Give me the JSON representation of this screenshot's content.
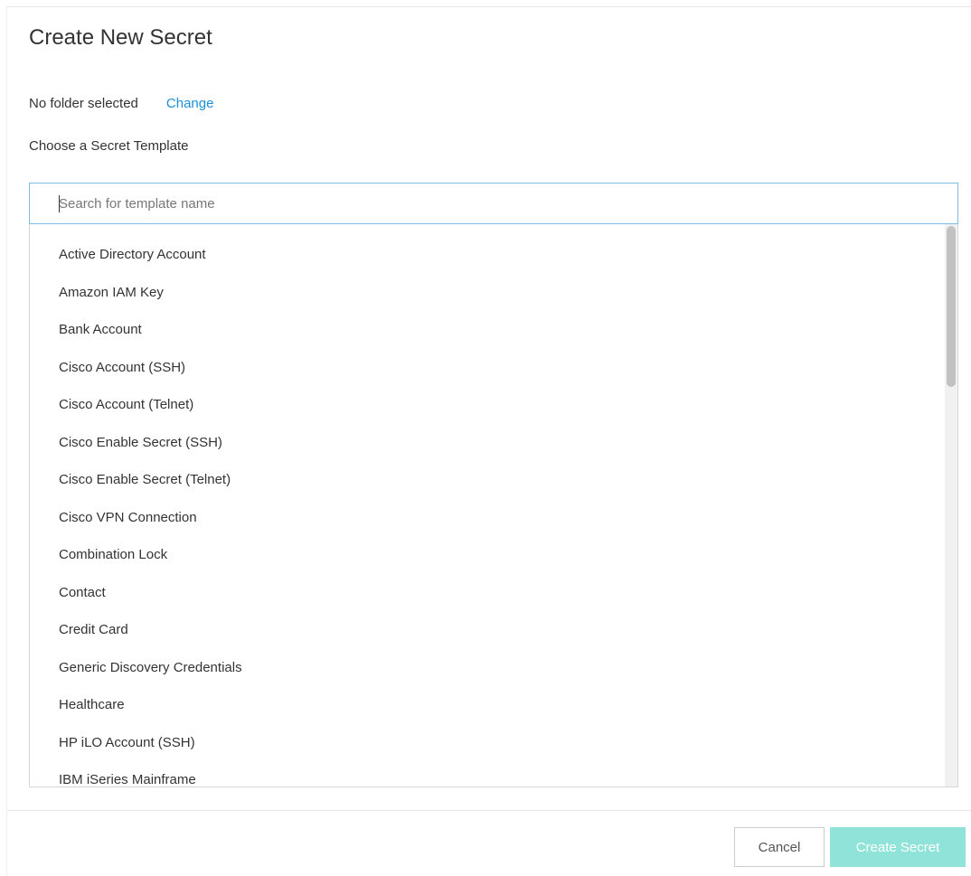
{
  "dialog": {
    "title": "Create New Secret"
  },
  "folder": {
    "status_text": "No folder selected",
    "change_label": "Change"
  },
  "template_section": {
    "label": "Choose a Secret Template",
    "search_placeholder": "Search for template name",
    "items": [
      "Active Directory Account",
      "Amazon IAM Key",
      "Bank Account",
      "Cisco Account (SSH)",
      "Cisco Account (Telnet)",
      "Cisco Enable Secret (SSH)",
      "Cisco Enable Secret (Telnet)",
      "Cisco VPN Connection",
      "Combination Lock",
      "Contact",
      "Credit Card",
      "Generic Discovery Credentials",
      "Healthcare",
      "HP iLO Account (SSH)",
      "IBM iSeries Mainframe"
    ]
  },
  "footer": {
    "cancel_label": "Cancel",
    "create_label": "Create Secret"
  },
  "colors": {
    "link": "#1a8fd8",
    "primary_disabled": "#8fe3d8",
    "search_border": "#7bbde6"
  }
}
